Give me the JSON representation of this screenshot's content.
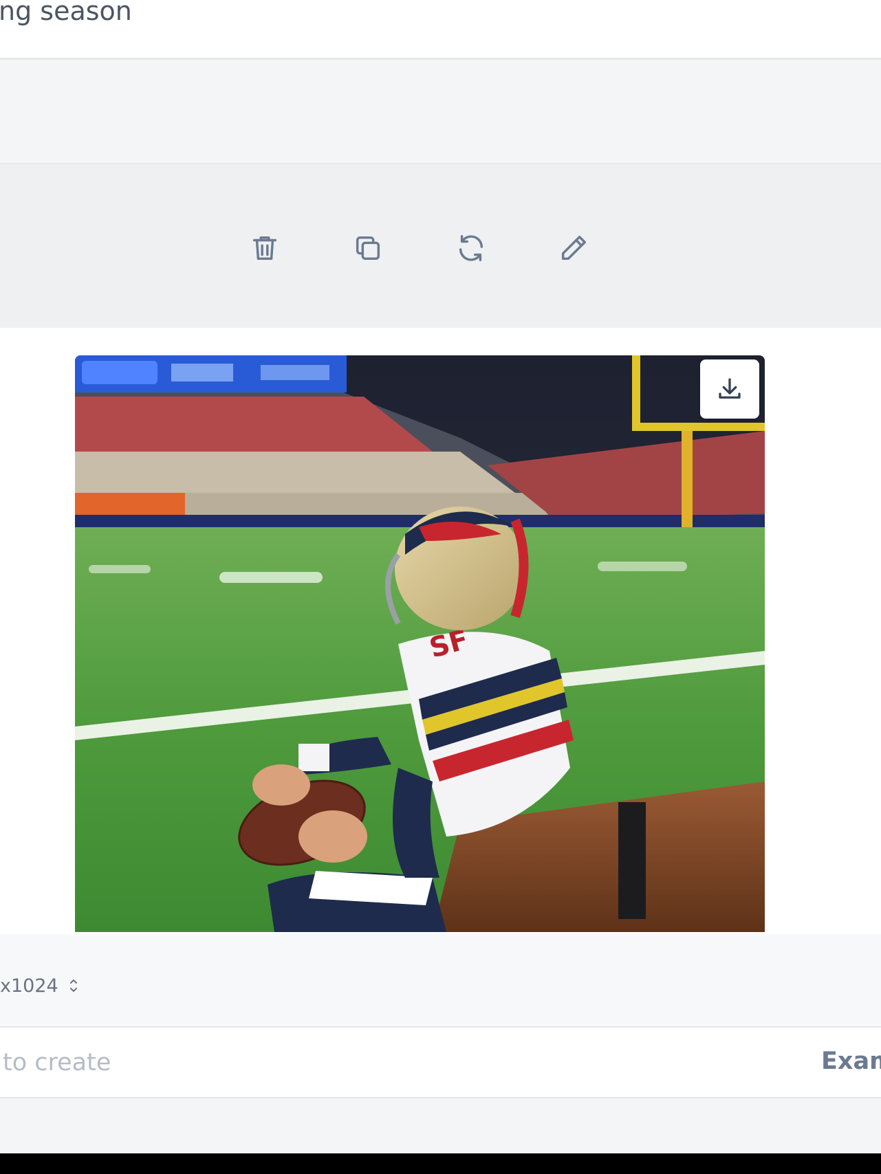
{
  "prompt": {
    "text": "ng season"
  },
  "toolbar": {
    "delete_icon": "trash-icon",
    "copy_icon": "copy-icon",
    "regenerate_icon": "refresh-icon",
    "edit_icon": "pencil-icon"
  },
  "image": {
    "download_icon": "download-icon",
    "jersey_text": "SF"
  },
  "settings": {
    "size_value": "x1024",
    "size_icon": "chevron-updown-icon"
  },
  "input": {
    "placeholder": "to create",
    "examples_label": "Exam"
  },
  "colors": {
    "toolbar_bg": "#eff0f2",
    "icon_color": "#6b7a90",
    "examples_color": "#6b7a90"
  }
}
